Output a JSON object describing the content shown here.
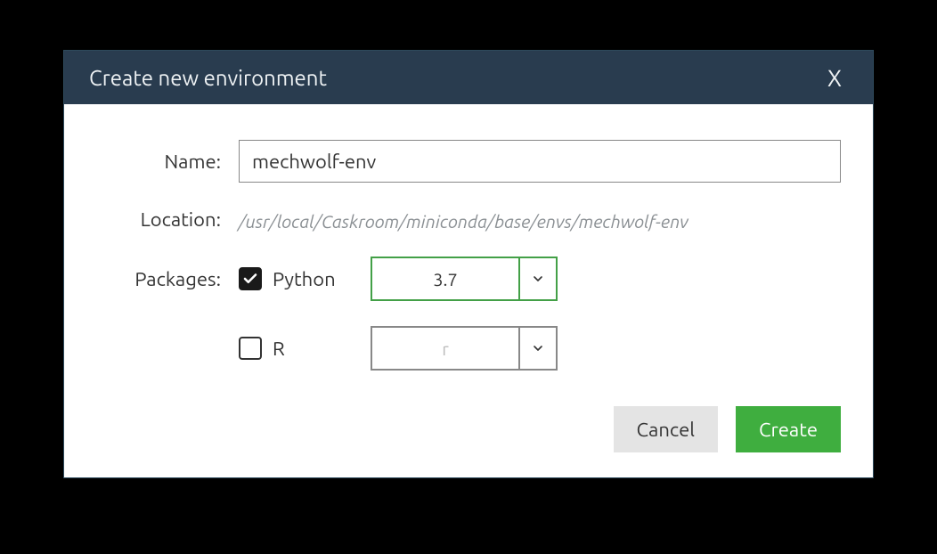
{
  "dialog": {
    "title": "Create new environment",
    "close_label": "X"
  },
  "fields": {
    "name_label": "Name:",
    "name_value": "mechwolf-env",
    "location_label": "Location:",
    "location_value": "/usr/local/Caskroom/miniconda/base/envs/mechwolf-env",
    "packages_label": "Packages:"
  },
  "packages": {
    "python": {
      "label": "Python",
      "checked": true,
      "version": "3.7"
    },
    "r": {
      "label": "R",
      "checked": false,
      "version": "r"
    }
  },
  "buttons": {
    "cancel": "Cancel",
    "create": "Create"
  },
  "colors": {
    "titlebar": "#293c4f",
    "accent_green": "#43a047",
    "button_green": "#3fae3f",
    "button_gray": "#e4e4e4"
  }
}
